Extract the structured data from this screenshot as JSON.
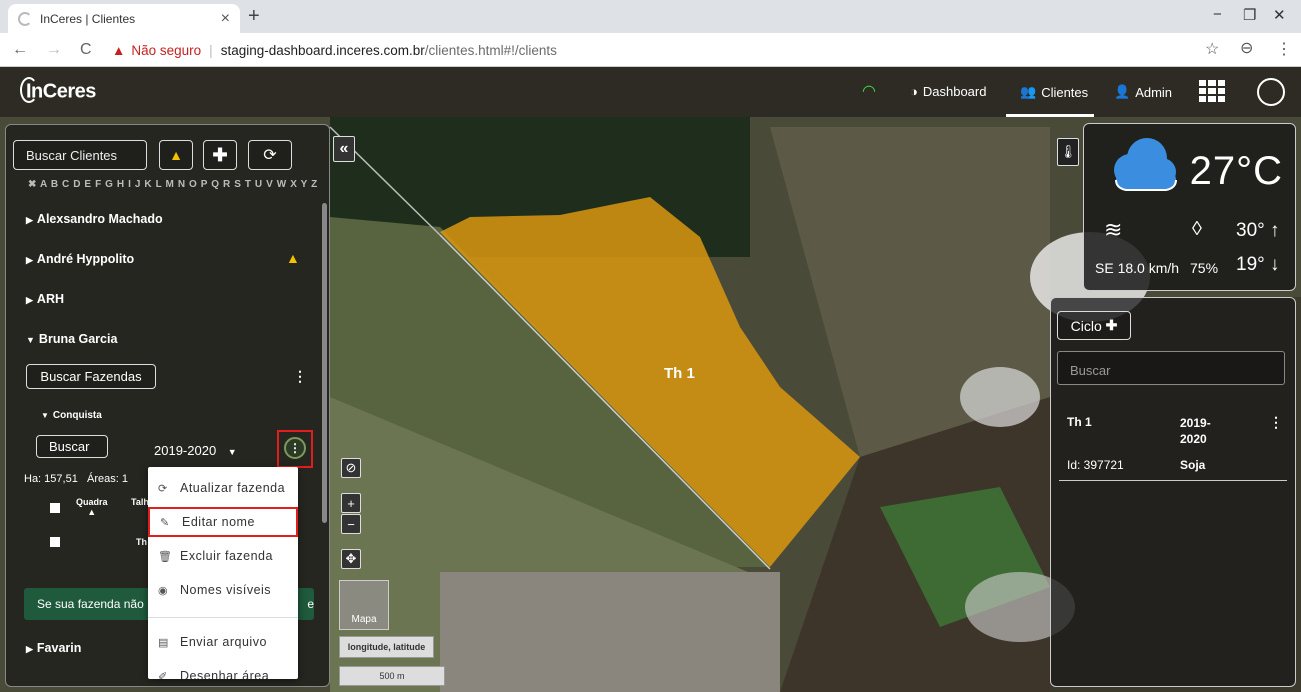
{
  "browser": {
    "tab_title": "InCeres | Clientes",
    "new_tab": "+",
    "window_min": "−",
    "window_max": "❐",
    "window_close": "✕",
    "tab_close": "×",
    "back": "←",
    "forward": "→",
    "reload": "C",
    "security_icon": "▲",
    "security_text": "Não seguro",
    "url_domain": "staging-dashboard.inceres.com.br",
    "url_path": "/clientes.html#!/clients",
    "star": "☆",
    "profile": "⊖",
    "menu": "⋮"
  },
  "header": {
    "logo": "InCeres",
    "nav": [
      {
        "label": "Dashboard",
        "icon": "dashboard-icon"
      },
      {
        "label": "Clientes",
        "icon": "users-icon"
      },
      {
        "label": "Admin",
        "icon": "user-plus-icon"
      }
    ],
    "active": "Clientes"
  },
  "clients_panel": {
    "search_label": "Buscar Clientes",
    "alphabet": "✖ A B C D E F G H I J K L M N O P Q R S T U V W X Y Z",
    "clients": [
      "Alexsandro Machado",
      "André Hyppolito",
      "ARH",
      "Bruna Garcia",
      "Favarin"
    ],
    "farm_search": "Buscar Fazendas",
    "farm_name": "Conquista",
    "search_btn": "Buscar",
    "season": "2019-2020",
    "ha_label": "Ha: 157,51",
    "areas_label": "Áreas: 1",
    "col_quadra": "Quadra",
    "col_talh": "Talh",
    "row_value": "Th",
    "banner": "Se sua fazenda não",
    "banner_tail": "e"
  },
  "farm_menu": {
    "items": [
      {
        "label": "Atualizar fazenda",
        "icon": "refresh-icon"
      },
      {
        "label": "Editar nome",
        "icon": "pencil-icon"
      },
      {
        "label": "Excluir fazenda",
        "icon": "trash-icon"
      },
      {
        "label": "Nomes visíveis",
        "icon": "eye-icon"
      },
      {
        "label": "Enviar arquivo",
        "icon": "file-icon"
      },
      {
        "label": "Desenhar área",
        "icon": "draw-icon"
      }
    ]
  },
  "map": {
    "field_label": "Th 1",
    "layer_label": "Mapa",
    "coords_label": "longitude, latitude",
    "scale_label": "500 m",
    "plus": "+",
    "minus": "−"
  },
  "weather": {
    "temp": "27°C",
    "wind": "SE 18.0 km/h",
    "humidity": "75%",
    "max": "30°",
    "min": "19°"
  },
  "cycle_panel": {
    "cycle_btn": "Ciclo",
    "search_placeholder": "Buscar",
    "field_name": "Th 1",
    "field_season_a": "2019-",
    "field_season_b": "2020",
    "field_id": "Id: 397721",
    "field_crop": "Soja"
  },
  "colors": {
    "field": "#d9960f",
    "warning": "#f2c200",
    "highlight": "#e11d1d",
    "banner": "#1f5a3c"
  }
}
